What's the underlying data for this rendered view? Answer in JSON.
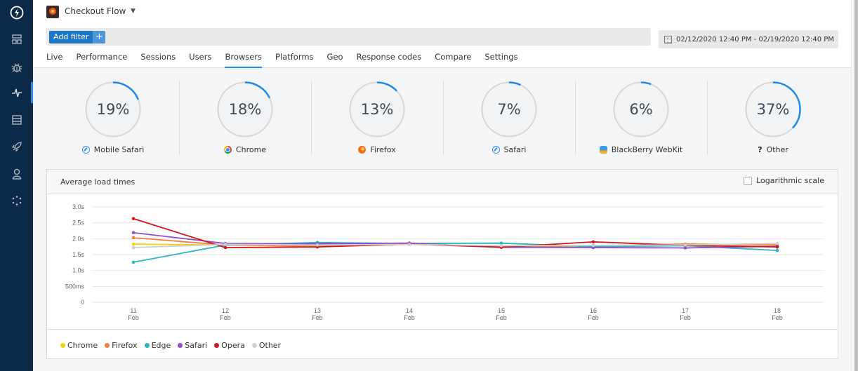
{
  "sidebar": {
    "items": [
      {
        "name": "logo",
        "icon": "lightning-bolt-icon"
      },
      {
        "name": "dashboards",
        "icon": "dashboard-grid-icon"
      },
      {
        "name": "errors",
        "icon": "bug-icon"
      },
      {
        "name": "performance",
        "icon": "pulse-icon",
        "active": true
      },
      {
        "name": "logs",
        "icon": "list-icon"
      },
      {
        "name": "deployments",
        "icon": "rocket-icon"
      },
      {
        "name": "users",
        "icon": "user-icon"
      },
      {
        "name": "integrations",
        "icon": "dots-circle-icon"
      }
    ]
  },
  "header": {
    "app_title": "Checkout Flow",
    "add_filter_label": "Add filter",
    "add_filter_plus": "+",
    "date_range": "02/12/2020 12:40 PM - 02/19/2020 12:40 PM",
    "tabs": [
      {
        "label": "Live"
      },
      {
        "label": "Performance"
      },
      {
        "label": "Sessions"
      },
      {
        "label": "Users"
      },
      {
        "label": "Browsers",
        "active": true
      },
      {
        "label": "Platforms"
      },
      {
        "label": "Geo"
      },
      {
        "label": "Response codes"
      },
      {
        "label": "Compare"
      },
      {
        "label": "Settings"
      }
    ]
  },
  "browser_stats": [
    {
      "name": "Mobile Safari",
      "percent": 19,
      "display": "19%",
      "icon": "safari-icon"
    },
    {
      "name": "Chrome",
      "percent": 18,
      "display": "18%",
      "icon": "chrome-icon"
    },
    {
      "name": "Firefox",
      "percent": 13,
      "display": "13%",
      "icon": "firefox-icon"
    },
    {
      "name": "Safari",
      "percent": 7,
      "display": "7%",
      "icon": "safari-icon"
    },
    {
      "name": "BlackBerry WebKit",
      "percent": 6,
      "display": "6%",
      "icon": "blackberry-webkit-icon"
    },
    {
      "name": "Other",
      "percent": 37,
      "display": "37%",
      "icon": "question-icon",
      "icon_text": "?"
    }
  ],
  "colors": {
    "accent": "#1e88e5",
    "sidebar_bg": "#0c2a48"
  },
  "chart_card": {
    "title": "Average load times",
    "log_scale_label": "Logarithmic scale",
    "log_scale_checked": false
  },
  "chart_data": {
    "type": "line",
    "title": "Average load times",
    "xlabel": "",
    "ylabel": "",
    "x": [
      "11 Feb",
      "12 Feb",
      "13 Feb",
      "14 Feb",
      "15 Feb",
      "16 Feb",
      "17 Feb",
      "18 Feb"
    ],
    "x_ticks": [
      {
        "day": "11",
        "month": "Feb"
      },
      {
        "day": "12",
        "month": "Feb"
      },
      {
        "day": "13",
        "month": "Feb"
      },
      {
        "day": "14",
        "month": "Feb"
      },
      {
        "day": "15",
        "month": "Feb"
      },
      {
        "day": "16",
        "month": "Feb"
      },
      {
        "day": "17",
        "month": "Feb"
      },
      {
        "day": "18",
        "month": "Feb"
      }
    ],
    "y_ticks": [
      {
        "value": 0,
        "label": "0"
      },
      {
        "value": 0.5,
        "label": "500ms"
      },
      {
        "value": 1.0,
        "label": "1.0s"
      },
      {
        "value": 1.5,
        "label": "1.5s"
      },
      {
        "value": 2.0,
        "label": "2.0s"
      },
      {
        "value": 2.5,
        "label": "2.5s"
      },
      {
        "value": 3.0,
        "label": "3.0s"
      }
    ],
    "ylim": [
      0,
      3.0
    ],
    "y_unit": "s",
    "grid": true,
    "legend_position": "bottom-left",
    "series": [
      {
        "name": "Chrome",
        "color": "#f5d20c",
        "values": [
          1.83,
          1.8,
          1.78,
          1.83,
          1.76,
          1.78,
          1.83,
          1.81
        ]
      },
      {
        "name": "Firefox",
        "color": "#f57c3d",
        "values": [
          2.03,
          1.8,
          1.76,
          1.82,
          1.75,
          1.77,
          1.83,
          1.8
        ]
      },
      {
        "name": "Edge",
        "color": "#2bb5c0",
        "values": [
          1.26,
          1.8,
          1.88,
          1.85,
          1.86,
          1.75,
          1.78,
          1.63
        ]
      },
      {
        "name": "Safari",
        "color": "#8c4fcf",
        "values": [
          2.19,
          1.85,
          1.84,
          1.86,
          1.73,
          1.72,
          1.71,
          1.76
        ]
      },
      {
        "name": "Opera",
        "color": "#d0161e",
        "values": [
          2.63,
          1.72,
          1.74,
          1.83,
          1.73,
          1.9,
          1.79,
          1.74
        ]
      },
      {
        "name": "Other",
        "color": "#cfcfcf",
        "values": [
          1.72,
          1.82,
          1.8,
          1.82,
          1.78,
          1.79,
          1.8,
          1.85
        ]
      }
    ]
  }
}
